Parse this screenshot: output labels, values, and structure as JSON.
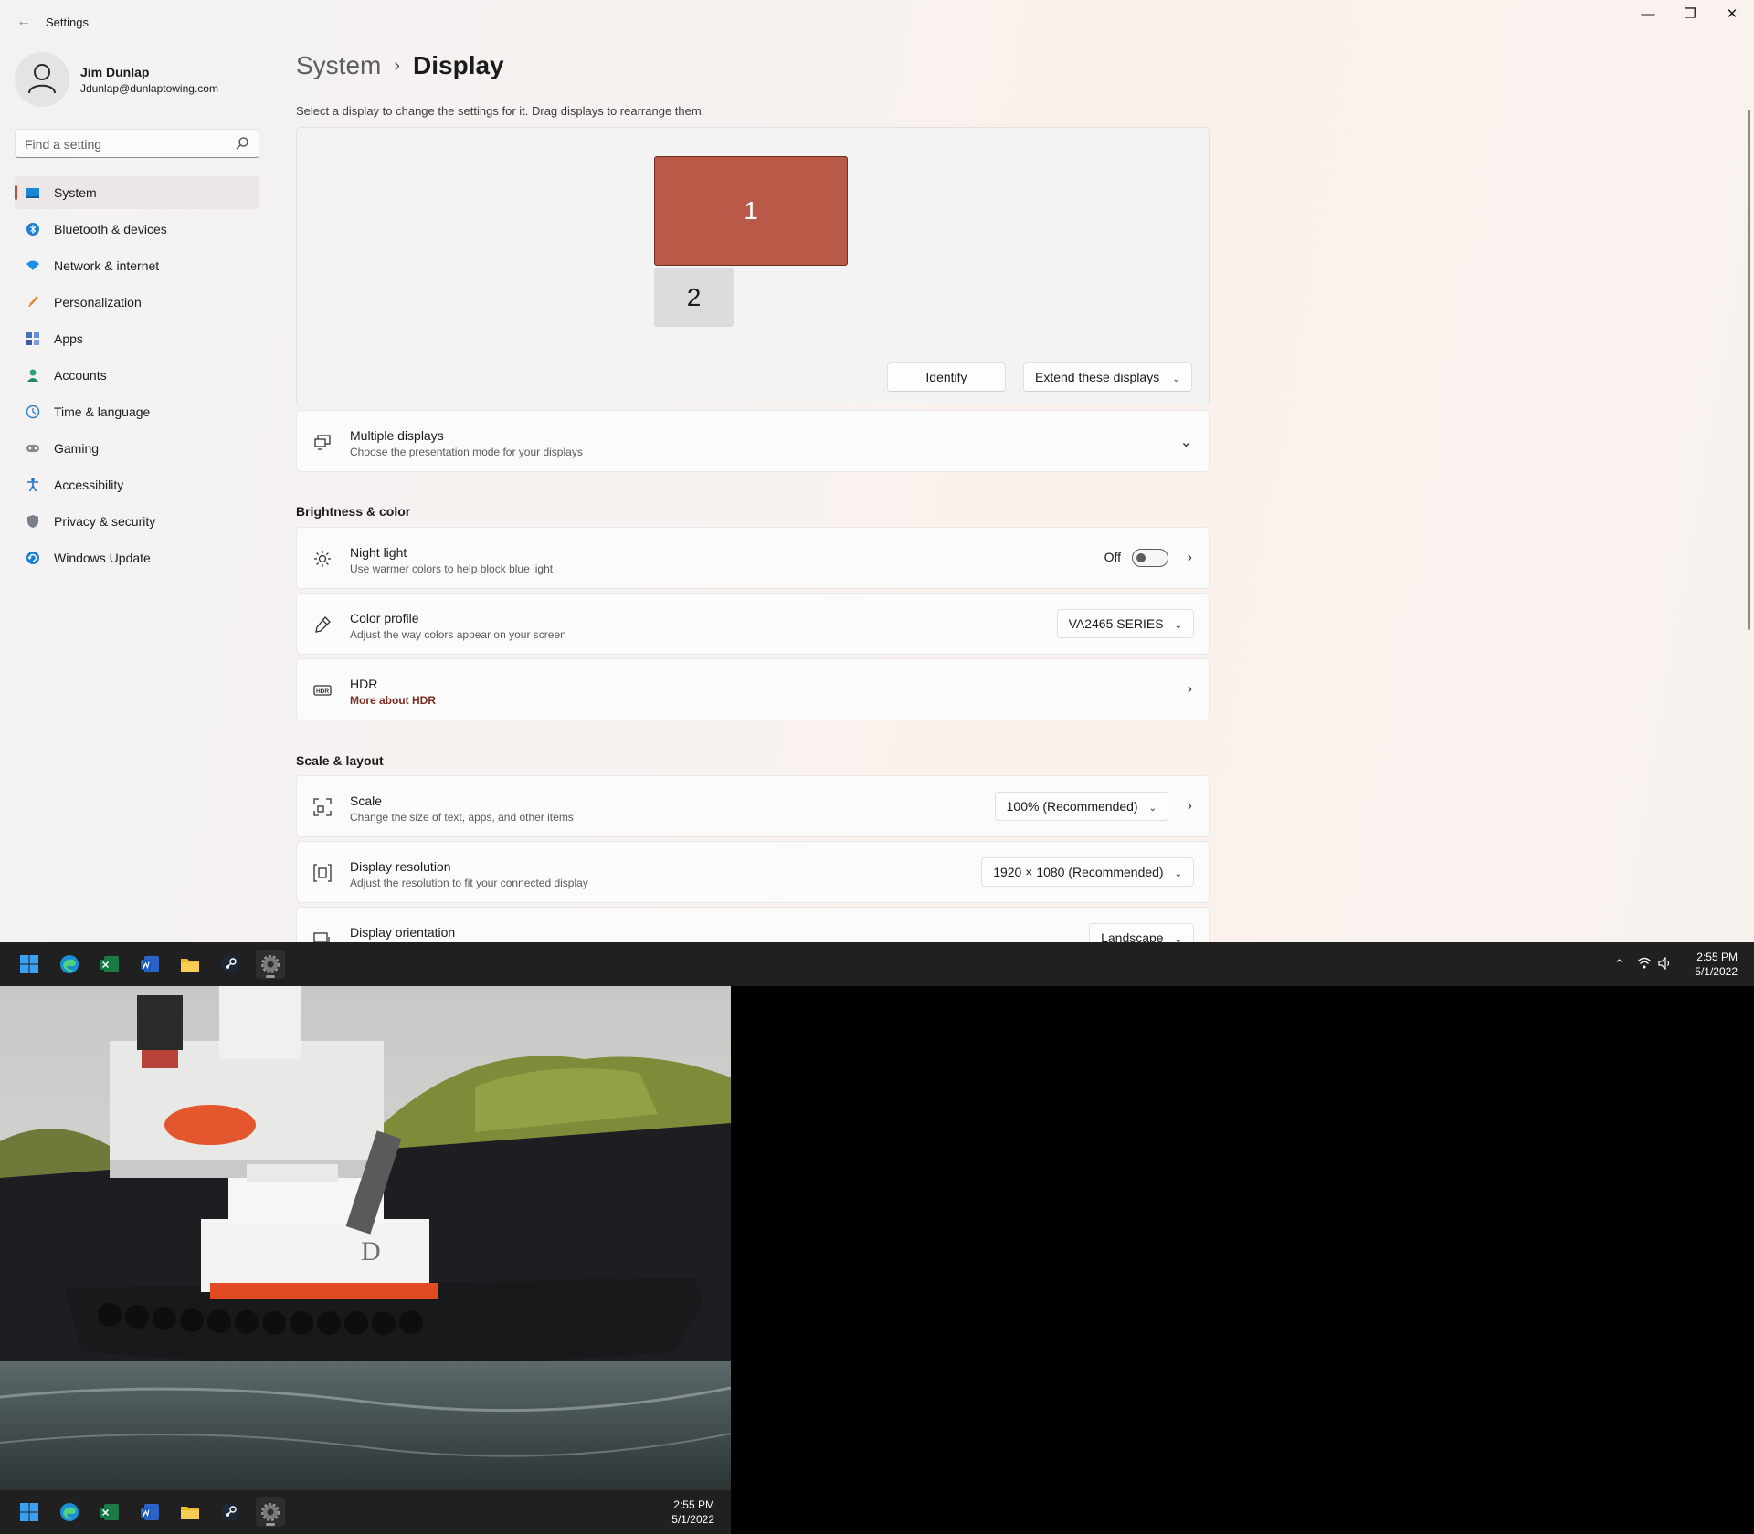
{
  "window": {
    "app_title": "Settings",
    "controls": {
      "minimize": "—",
      "maximize": "❐",
      "close": "✕"
    }
  },
  "profile": {
    "name": "Jim Dunlap",
    "email": "Jdunlap@dunlaptowing.com"
  },
  "search": {
    "placeholder": "Find a setting"
  },
  "nav": {
    "items": [
      {
        "label": "System",
        "icon": "system-icon",
        "active": true
      },
      {
        "label": "Bluetooth & devices",
        "icon": "bluetooth-icon"
      },
      {
        "label": "Network & internet",
        "icon": "wifi-icon"
      },
      {
        "label": "Personalization",
        "icon": "brush-icon"
      },
      {
        "label": "Apps",
        "icon": "apps-icon"
      },
      {
        "label": "Accounts",
        "icon": "person-icon"
      },
      {
        "label": "Time & language",
        "icon": "clock-globe-icon"
      },
      {
        "label": "Gaming",
        "icon": "gamepad-icon"
      },
      {
        "label": "Accessibility",
        "icon": "accessibility-icon"
      },
      {
        "label": "Privacy & security",
        "icon": "shield-icon"
      },
      {
        "label": "Windows Update",
        "icon": "update-icon"
      }
    ]
  },
  "breadcrumb": {
    "parent": "System",
    "separator": "›",
    "current": "Display"
  },
  "arrangement": {
    "hint": "Select a display to change the settings for it. Drag displays to rearrange them.",
    "monitor1": "1",
    "monitor2": "2",
    "identify_label": "Identify",
    "mode_label": "Extend these displays"
  },
  "multiple_displays": {
    "title": "Multiple displays",
    "subtitle": "Choose the presentation mode for your displays"
  },
  "brightness_section": "Brightness & color",
  "night_light": {
    "title": "Night light",
    "subtitle": "Use warmer colors to help block blue light",
    "state": "Off"
  },
  "color_profile": {
    "title": "Color profile",
    "subtitle": "Adjust the way colors appear on your screen",
    "value": "VA2465 SERIES"
  },
  "hdr": {
    "title": "HDR",
    "link": "More about HDR"
  },
  "scale_section": "Scale & layout",
  "scale": {
    "title": "Scale",
    "subtitle": "Change the size of text, apps, and other items",
    "value": "100% (Recommended)"
  },
  "resolution": {
    "title": "Display resolution",
    "subtitle": "Adjust the resolution to fit your connected display",
    "value": "1920 × 1080 (Recommended)"
  },
  "orientation": {
    "title": "Display orientation",
    "value": "Landscape"
  },
  "taskbar": {
    "time": "2:55 PM",
    "date": "5/1/2022",
    "apps": [
      "windows-start-icon",
      "edge-icon",
      "excel-icon",
      "word-icon",
      "file-explorer-icon",
      "steam-icon",
      "settings-icon"
    ]
  },
  "colors": {
    "accent": "#b24f3d",
    "monitor_primary": "#b85a47",
    "taskbar": "#202020"
  }
}
